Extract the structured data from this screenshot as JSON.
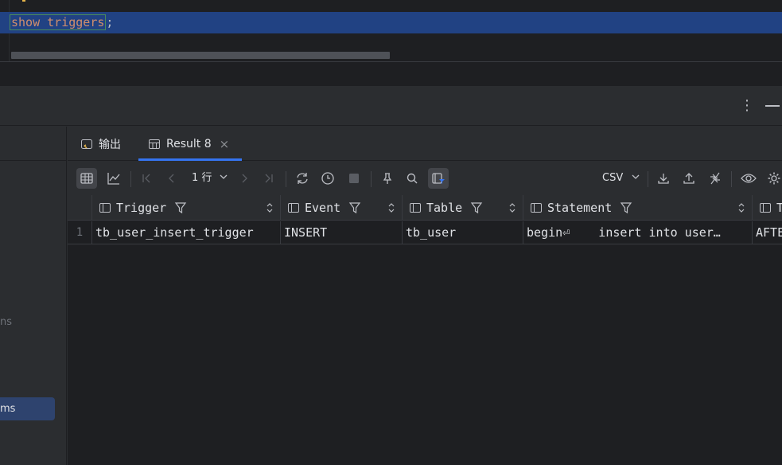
{
  "editor": {
    "code_keyword": "show triggers",
    "code_semicolon": ";"
  },
  "sidebar": {
    "item_1_label": "ns",
    "item_2_label": "ms"
  },
  "tabs": [
    {
      "label": "输出"
    },
    {
      "label": "Result 8"
    }
  ],
  "toolbar": {
    "rows_label": "1 行",
    "export_format": "CSV"
  },
  "grid": {
    "columns": [
      {
        "label": "Trigger"
      },
      {
        "label": "Event"
      },
      {
        "label": "Table"
      },
      {
        "label": "Statement"
      },
      {
        "label": "T"
      }
    ],
    "rows": [
      {
        "num": "1",
        "cells": [
          "tb_user_insert_trigger",
          "INSERT",
          "tb_user",
          "begin⏎    insert into user…",
          "AFTE"
        ]
      }
    ]
  }
}
